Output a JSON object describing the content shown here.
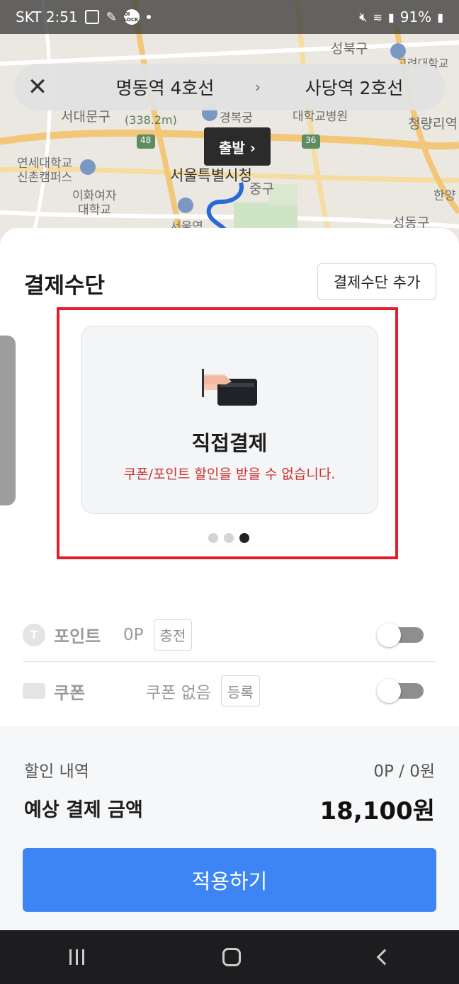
{
  "status_bar": {
    "carrier_time": "SKT 2:51",
    "battery": "91%",
    "lock_badge": "OI LOCK"
  },
  "map": {
    "labels": [
      "성북구",
      "고려대학교",
      "서대문구",
      "(338.2m)",
      "경복궁",
      "대학교병원",
      "청량리역",
      "연세대학교",
      "신촌캠퍼스",
      "서울특별시청",
      "이화여자",
      "대학교",
      "중구",
      "한양",
      "서울역",
      "성동구",
      "48",
      "36"
    ]
  },
  "route": {
    "from": "명동역 4호선",
    "to": "사당역 2호선",
    "arrow": "›",
    "depart_label": "출발 ›"
  },
  "payment": {
    "title": "결제수단",
    "add_button": "결제수단 추가",
    "card_name": "직접결제",
    "card_desc": "쿠폰/포인트 할인을 받을 수 없습니다."
  },
  "points": {
    "icon_char": "T",
    "label": "포인트",
    "value": "0P",
    "charge_button": "충전"
  },
  "coupon": {
    "label": "쿠폰",
    "value": "쿠폰 없음",
    "register_button": "등록"
  },
  "summary": {
    "discount_label": "할인 내역",
    "discount_value": "0P / 0원",
    "total_label": "예상 결제 금액",
    "total_value": "18,100원",
    "apply_button": "적용하기"
  },
  "colors": {
    "primary": "#3d84f5",
    "highlight": "#e41d2a",
    "warning_text": "#c83232"
  }
}
